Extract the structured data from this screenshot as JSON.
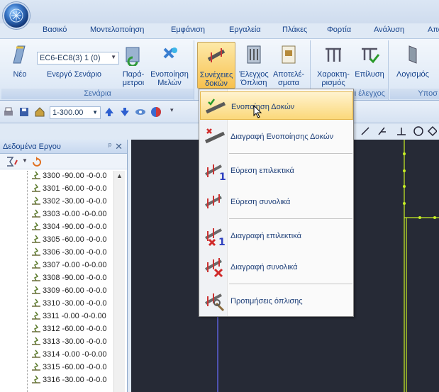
{
  "tabs": [
    "Βασικό",
    "Μοντελοποίηση",
    "Εμφάνιση",
    "Εργαλεία",
    "Πλάκες",
    "Φορτία",
    "Ανάλυση",
    "Απο"
  ],
  "ribbon": {
    "scenario_combo": "EC6-EC8(3) 1 (0)",
    "buttons": {
      "new": "Νέο",
      "active_scenario": "Ενεργό Σενάριο",
      "parameters": [
        "Παρά-",
        "μετροι"
      ],
      "unify_members": [
        "Ενοποίηση",
        "Μελών"
      ],
      "continuous_beams": [
        "Συνέχειες",
        "δοκών"
      ],
      "check_reinforcement": [
        "Έλεγχος",
        "Όπλιση"
      ],
      "results": [
        "Αποτελέ-",
        "σματα"
      ],
      "characterization": [
        "Χαρακτη-",
        "ρισμός"
      ],
      "solution": "Επίλυση",
      "calculation": "Λογισμός"
    },
    "group_labels": {
      "scenarios": "Σενάρια",
      "checks": "ι έλεγχος",
      "next": "Υποσ"
    }
  },
  "toolbar": {
    "scale": "1-300.00"
  },
  "panel": {
    "title": "Δεδομένα Εργου",
    "pin": "ᵖ",
    "close": "✕",
    "rows": [
      "3300 -90.00 -0-0.0",
      "3301 -60.00 -0-0.0",
      "3302 -30.00 -0-0.0",
      "3303 -0.00 -0-0.00",
      "3304 -90.00 -0-0.0",
      "3305 -60.00 -0-0.0",
      "3306 -30.00 -0-0.0",
      "3307 -0.00 -0-0.00",
      "3308 -90.00 -0-0.0",
      "3309 -60.00 -0-0.0",
      "3310 -30.00 -0-0.0",
      "3311 -0.00 -0-0.00",
      "3312 -60.00 -0-0.0",
      "3313 -30.00 -0-0.0",
      "3314 -0.00 -0-0.00",
      "3315 -60.00 -0-0.0",
      "3316 -30.00 -0-0.0"
    ]
  },
  "menu": {
    "items": [
      {
        "label": "Ενοποίηση Δοκών",
        "icon": "beam-unify-icon"
      },
      {
        "label": "Διαγραφή Ενοποίησης Δοκών",
        "icon": "beam-unify-delete-icon"
      },
      {
        "label": "Εύρεση επιλεκτικά",
        "icon": "find-selective-icon"
      },
      {
        "label": "Εύρεση συνολικά",
        "icon": "find-all-icon"
      },
      {
        "label": "Διαγραφή επιλεκτικά",
        "icon": "delete-selective-icon"
      },
      {
        "label": "Διαγραφή συνολικά",
        "icon": "delete-all-icon"
      },
      {
        "label": "Προτιμήσεις όπλισης",
        "icon": "reinforcement-preferences-icon"
      }
    ]
  },
  "colors": {
    "accent": "#15428b",
    "highlight": "#fbd87a",
    "canvas": "#262a36",
    "structure_line": "#c8f024"
  }
}
